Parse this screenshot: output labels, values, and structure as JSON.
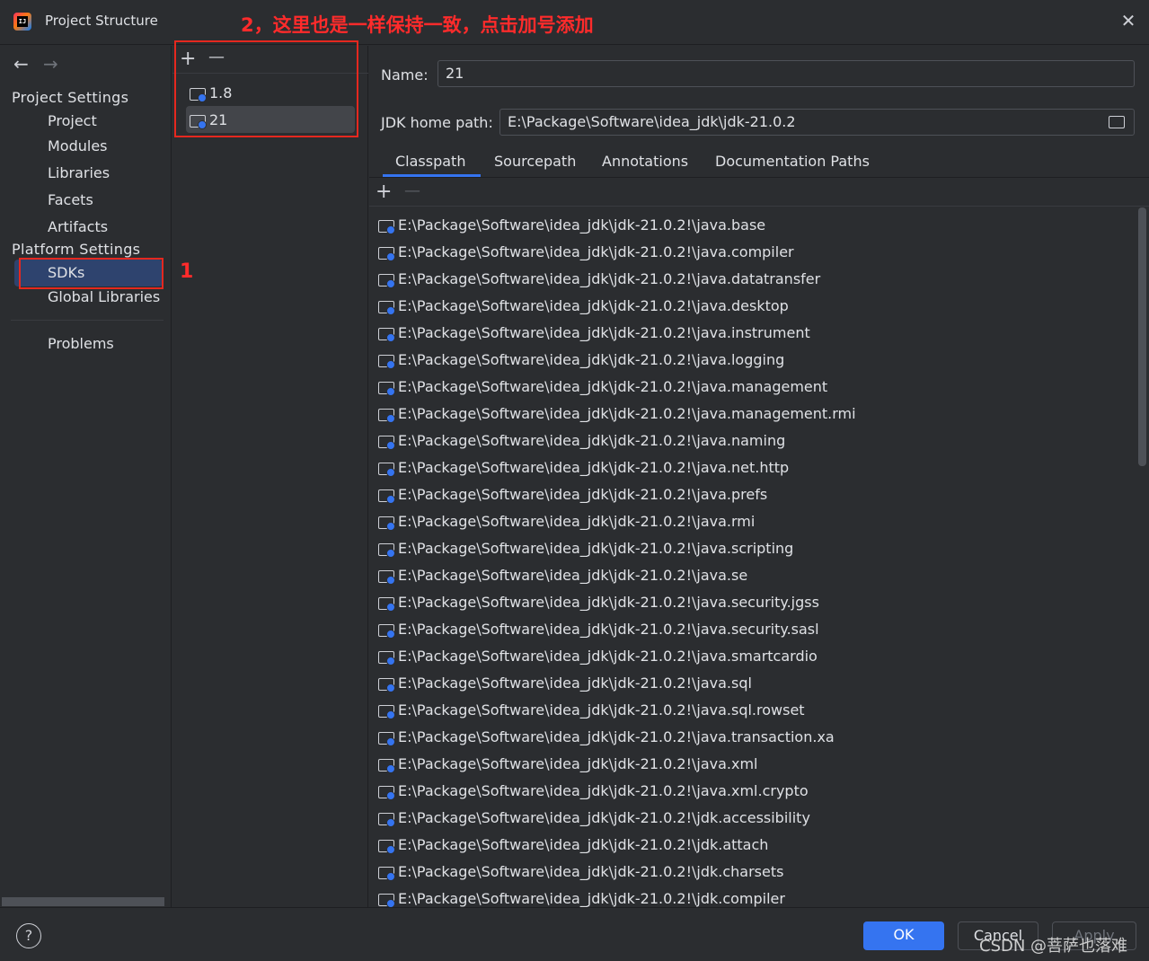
{
  "window": {
    "title": "Project Structure"
  },
  "annotations": {
    "step2": "2，这里也是一样保持一致，点击加号添加",
    "step1": "1"
  },
  "nav": {
    "project_settings": "Project Settings",
    "project_items": [
      "Project",
      "Modules",
      "Libraries",
      "Facets",
      "Artifacts"
    ],
    "platform_settings": "Platform Settings",
    "platform_items": [
      "SDKs",
      "Global Libraries"
    ],
    "selected": "SDKs",
    "problems": "Problems"
  },
  "sdk_list": {
    "add": "+",
    "remove": "—",
    "items": [
      "1.8",
      "21"
    ],
    "selected": "21"
  },
  "detail": {
    "name_label": "Name:",
    "name_value": "21",
    "home_label": "JDK home path:",
    "home_value": "E:\\Package\\Software\\idea_jdk\\jdk-21.0.2",
    "tabs": [
      "Classpath",
      "Sourcepath",
      "Annotations",
      "Documentation Paths"
    ],
    "active_tab": "Classpath",
    "cp_add": "+",
    "cp_remove": "—",
    "classpath": [
      "E:\\Package\\Software\\idea_jdk\\jdk-21.0.2!\\java.base",
      "E:\\Package\\Software\\idea_jdk\\jdk-21.0.2!\\java.compiler",
      "E:\\Package\\Software\\idea_jdk\\jdk-21.0.2!\\java.datatransfer",
      "E:\\Package\\Software\\idea_jdk\\jdk-21.0.2!\\java.desktop",
      "E:\\Package\\Software\\idea_jdk\\jdk-21.0.2!\\java.instrument",
      "E:\\Package\\Software\\idea_jdk\\jdk-21.0.2!\\java.logging",
      "E:\\Package\\Software\\idea_jdk\\jdk-21.0.2!\\java.management",
      "E:\\Package\\Software\\idea_jdk\\jdk-21.0.2!\\java.management.rmi",
      "E:\\Package\\Software\\idea_jdk\\jdk-21.0.2!\\java.naming",
      "E:\\Package\\Software\\idea_jdk\\jdk-21.0.2!\\java.net.http",
      "E:\\Package\\Software\\idea_jdk\\jdk-21.0.2!\\java.prefs",
      "E:\\Package\\Software\\idea_jdk\\jdk-21.0.2!\\java.rmi",
      "E:\\Package\\Software\\idea_jdk\\jdk-21.0.2!\\java.scripting",
      "E:\\Package\\Software\\idea_jdk\\jdk-21.0.2!\\java.se",
      "E:\\Package\\Software\\idea_jdk\\jdk-21.0.2!\\java.security.jgss",
      "E:\\Package\\Software\\idea_jdk\\jdk-21.0.2!\\java.security.sasl",
      "E:\\Package\\Software\\idea_jdk\\jdk-21.0.2!\\java.smartcardio",
      "E:\\Package\\Software\\idea_jdk\\jdk-21.0.2!\\java.sql",
      "E:\\Package\\Software\\idea_jdk\\jdk-21.0.2!\\java.sql.rowset",
      "E:\\Package\\Software\\idea_jdk\\jdk-21.0.2!\\java.transaction.xa",
      "E:\\Package\\Software\\idea_jdk\\jdk-21.0.2!\\java.xml",
      "E:\\Package\\Software\\idea_jdk\\jdk-21.0.2!\\java.xml.crypto",
      "E:\\Package\\Software\\idea_jdk\\jdk-21.0.2!\\jdk.accessibility",
      "E:\\Package\\Software\\idea_jdk\\jdk-21.0.2!\\jdk.attach",
      "E:\\Package\\Software\\idea_jdk\\jdk-21.0.2!\\jdk.charsets",
      "E:\\Package\\Software\\idea_jdk\\jdk-21.0.2!\\jdk.compiler"
    ]
  },
  "footer": {
    "help": "?",
    "ok": "OK",
    "cancel": "Cancel",
    "apply": "Apply",
    "watermark": "CSDN @菩萨也落难"
  },
  "colors": {
    "accent": "#3574f0",
    "annotation": "#ff2b2b",
    "background": "#2b2d30"
  }
}
